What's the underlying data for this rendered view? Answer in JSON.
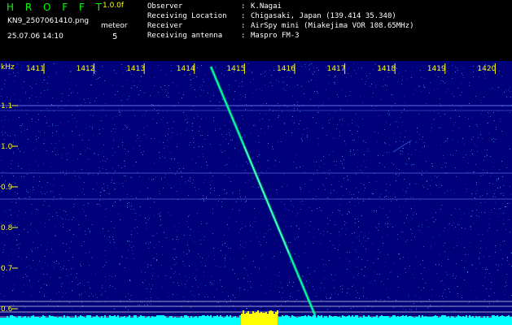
{
  "header": {
    "title": "H R O F F T",
    "version": "1.0.0f",
    "filename": "KN9_2507061410.png",
    "datetime": "25.07.06 14:10",
    "meteor_label": "meteor",
    "meteor_count": "5"
  },
  "metadata": [
    {
      "label": "Observer",
      "value": "K.Nagai"
    },
    {
      "label": "Receiving Location",
      "value": "Chigasaki, Japan (139.414 35.340)"
    },
    {
      "label": "Receiver",
      "value": "AirSpy mini (Miakejima VOR 108.65MHz)"
    },
    {
      "label": "Receiving antenna",
      "value": "Maspro FM-3"
    }
  ],
  "plot": {
    "y_unit": "kHz",
    "x_ticks": [
      "1411",
      "1412",
      "1413",
      "1414",
      "1415",
      "1416",
      "1417",
      "1418",
      "1419",
      "1420"
    ],
    "y_ticks": [
      "1.1",
      "1.0",
      "0.9",
      "0.8",
      "0.7",
      "0.6"
    ],
    "colors": {
      "background": "#00007a",
      "axis_text": "#ffff00",
      "trail": "#00ff99",
      "noise_floor": "#00ffff",
      "echo_burst": "#ffff00",
      "reference_lines": "#ffffff"
    }
  }
}
